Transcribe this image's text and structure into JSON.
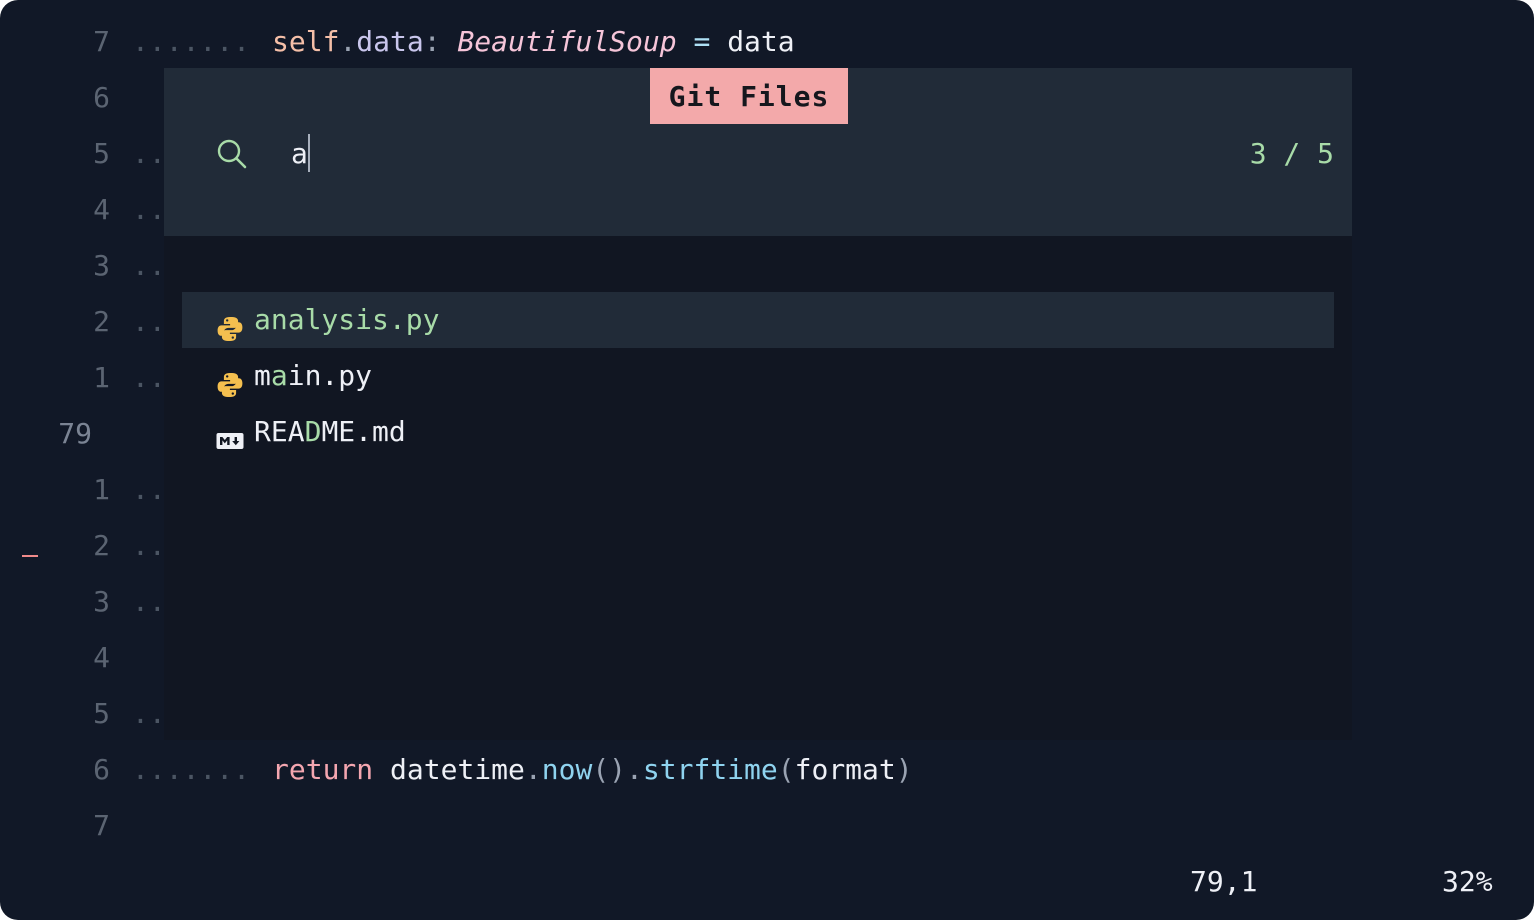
{
  "editor_lines": [
    {
      "num": "7",
      "dots": ".......",
      "segments": [
        {
          "text": "self",
          "cls": "kw-self"
        },
        {
          "text": ".",
          "cls": "punc"
        },
        {
          "text": "data",
          "cls": "attr"
        },
        {
          "text": ": ",
          "cls": "punc"
        },
        {
          "text": "BeautifulSoup",
          "cls": "type"
        },
        {
          "text": " = ",
          "cls": "op"
        },
        {
          "text": "data",
          "cls": "plain"
        }
      ]
    },
    {
      "num": "6",
      "dots": "",
      "segments": []
    },
    {
      "num": "5",
      "dots": "..",
      "segments": []
    },
    {
      "num": "4",
      "dots": "..",
      "segments": []
    },
    {
      "num": "3",
      "dots": "..",
      "segments": []
    },
    {
      "num": "2",
      "dots": "..",
      "segments": []
    },
    {
      "num": "1",
      "dots": "..",
      "segments": []
    },
    {
      "num": "79",
      "dots": "",
      "segments": [],
      "current": true
    },
    {
      "num": "1",
      "dots": "..",
      "segments": []
    },
    {
      "num": "2",
      "dots": "..",
      "segments": []
    },
    {
      "num": "3",
      "dots": "..",
      "segments": []
    },
    {
      "num": "4",
      "dots": "",
      "segments": []
    },
    {
      "num": "5",
      "dots": "..",
      "segments": []
    },
    {
      "num": "6",
      "dots": ".......",
      "segments": [
        {
          "text": "return",
          "cls": "kw-return"
        },
        {
          "text": " datetime",
          "cls": "plain"
        },
        {
          "text": ".",
          "cls": "punc"
        },
        {
          "text": "now",
          "cls": "method"
        },
        {
          "text": "()",
          "cls": "punc"
        },
        {
          "text": ".",
          "cls": "punc"
        },
        {
          "text": "strftime",
          "cls": "method"
        },
        {
          "text": "(",
          "cls": "punc"
        },
        {
          "text": "format",
          "cls": "plain"
        },
        {
          "text": ")",
          "cls": "punc"
        }
      ]
    },
    {
      "num": "7",
      "dots": "",
      "segments": []
    }
  ],
  "picker": {
    "title": "Git Files",
    "query": "a",
    "counter": "3 / 5",
    "results": [
      {
        "name": "analysis.py",
        "icon": "python-file-icon",
        "selected": true
      },
      {
        "name": "main.py",
        "icon": "python-file-icon",
        "selected": false,
        "highlight_index": 1
      },
      {
        "name": "README.md",
        "icon": "markdown-file-icon",
        "selected": false,
        "highlight_index": 3
      }
    ]
  },
  "status": {
    "position": "79,1",
    "percent": "32%"
  },
  "colors": {
    "background": "#111827",
    "picker_header": "#212b38",
    "title_badge": "#f3a9aa",
    "match_green": "#a8dba8"
  }
}
